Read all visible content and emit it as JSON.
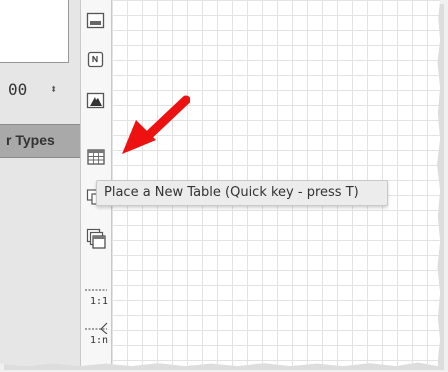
{
  "left_panel": {
    "spinner_value": "00",
    "spinner_icon": "up-down-arrows-icon",
    "section_header": "r Types"
  },
  "toolbar": {
    "tools": [
      {
        "name": "text-box-tool",
        "icon": "text-box-icon"
      },
      {
        "name": "note-tool",
        "icon": "note-icon"
      },
      {
        "name": "image-tool",
        "icon": "image-icon"
      },
      {
        "name": "table-tool",
        "icon": "table-icon"
      },
      {
        "name": "view-tool",
        "icon": "view-icon"
      },
      {
        "name": "multi-table-tool",
        "icon": "multi-table-icon"
      }
    ],
    "relationship_one_to_one": "1:1",
    "relationship_one_to_many": "1:n"
  },
  "tooltip": {
    "text": "Place a New Table (Quick key - press T)"
  },
  "annotation": {
    "arrow_color": "#ee1111"
  },
  "colors": {
    "canvas_grid": "#e3e3e3",
    "panel_bg": "#e6e6e6",
    "header_bg": "#a9a9a9"
  }
}
